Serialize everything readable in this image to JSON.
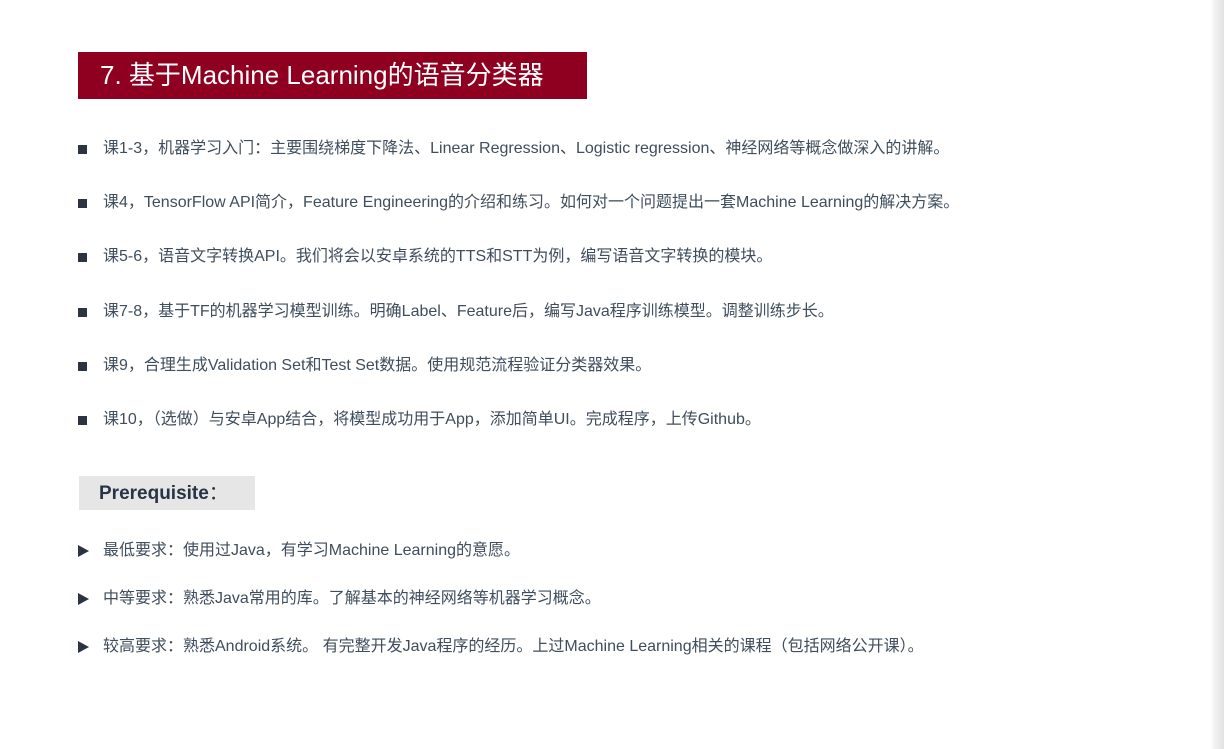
{
  "section": {
    "title": "7. 基于Machine Learning的语音分类器"
  },
  "courses": [
    "课1-3，机器学习入门：主要围绕梯度下降法、Linear Regression、Logistic regression、神经网络等概念做深入的讲解。",
    "课4，TensorFlow API简介，Feature Engineering的介绍和练习。如何对一个问题提出一套Machine Learning的解决方案。",
    "课5-6，语音文字转换API。我们将会以安卓系统的TTS和STT为例，编写语音文字转换的模块。",
    "课7-8，基于TF的机器学习模型训练。明确Label、Feature后，编写Java程序训练模型。调整训练步长。",
    "课9，合理生成Validation Set和Test Set数据。使用规范流程验证分类器效果。",
    "课10，（选做）与安卓App结合，将模型成功用于App，添加简单UI。完成程序，上传Github。"
  ],
  "prerequisite": {
    "title": "Prerequisite",
    "colon": "：",
    "items": [
      "最低要求：使用过Java，有学习Machine Learning的意愿。",
      "中等要求：熟悉Java常用的库。了解基本的神经网络等机器学习概念。",
      "较高要求：熟悉Android系统。 有完整开发Java程序的经历。上过Machine Learning相关的课程（包括网络公开课）。"
    ]
  },
  "colors": {
    "banner": "#8f0020",
    "text": "#3f4d5d",
    "prereq_bg": "#e6e6e6"
  }
}
